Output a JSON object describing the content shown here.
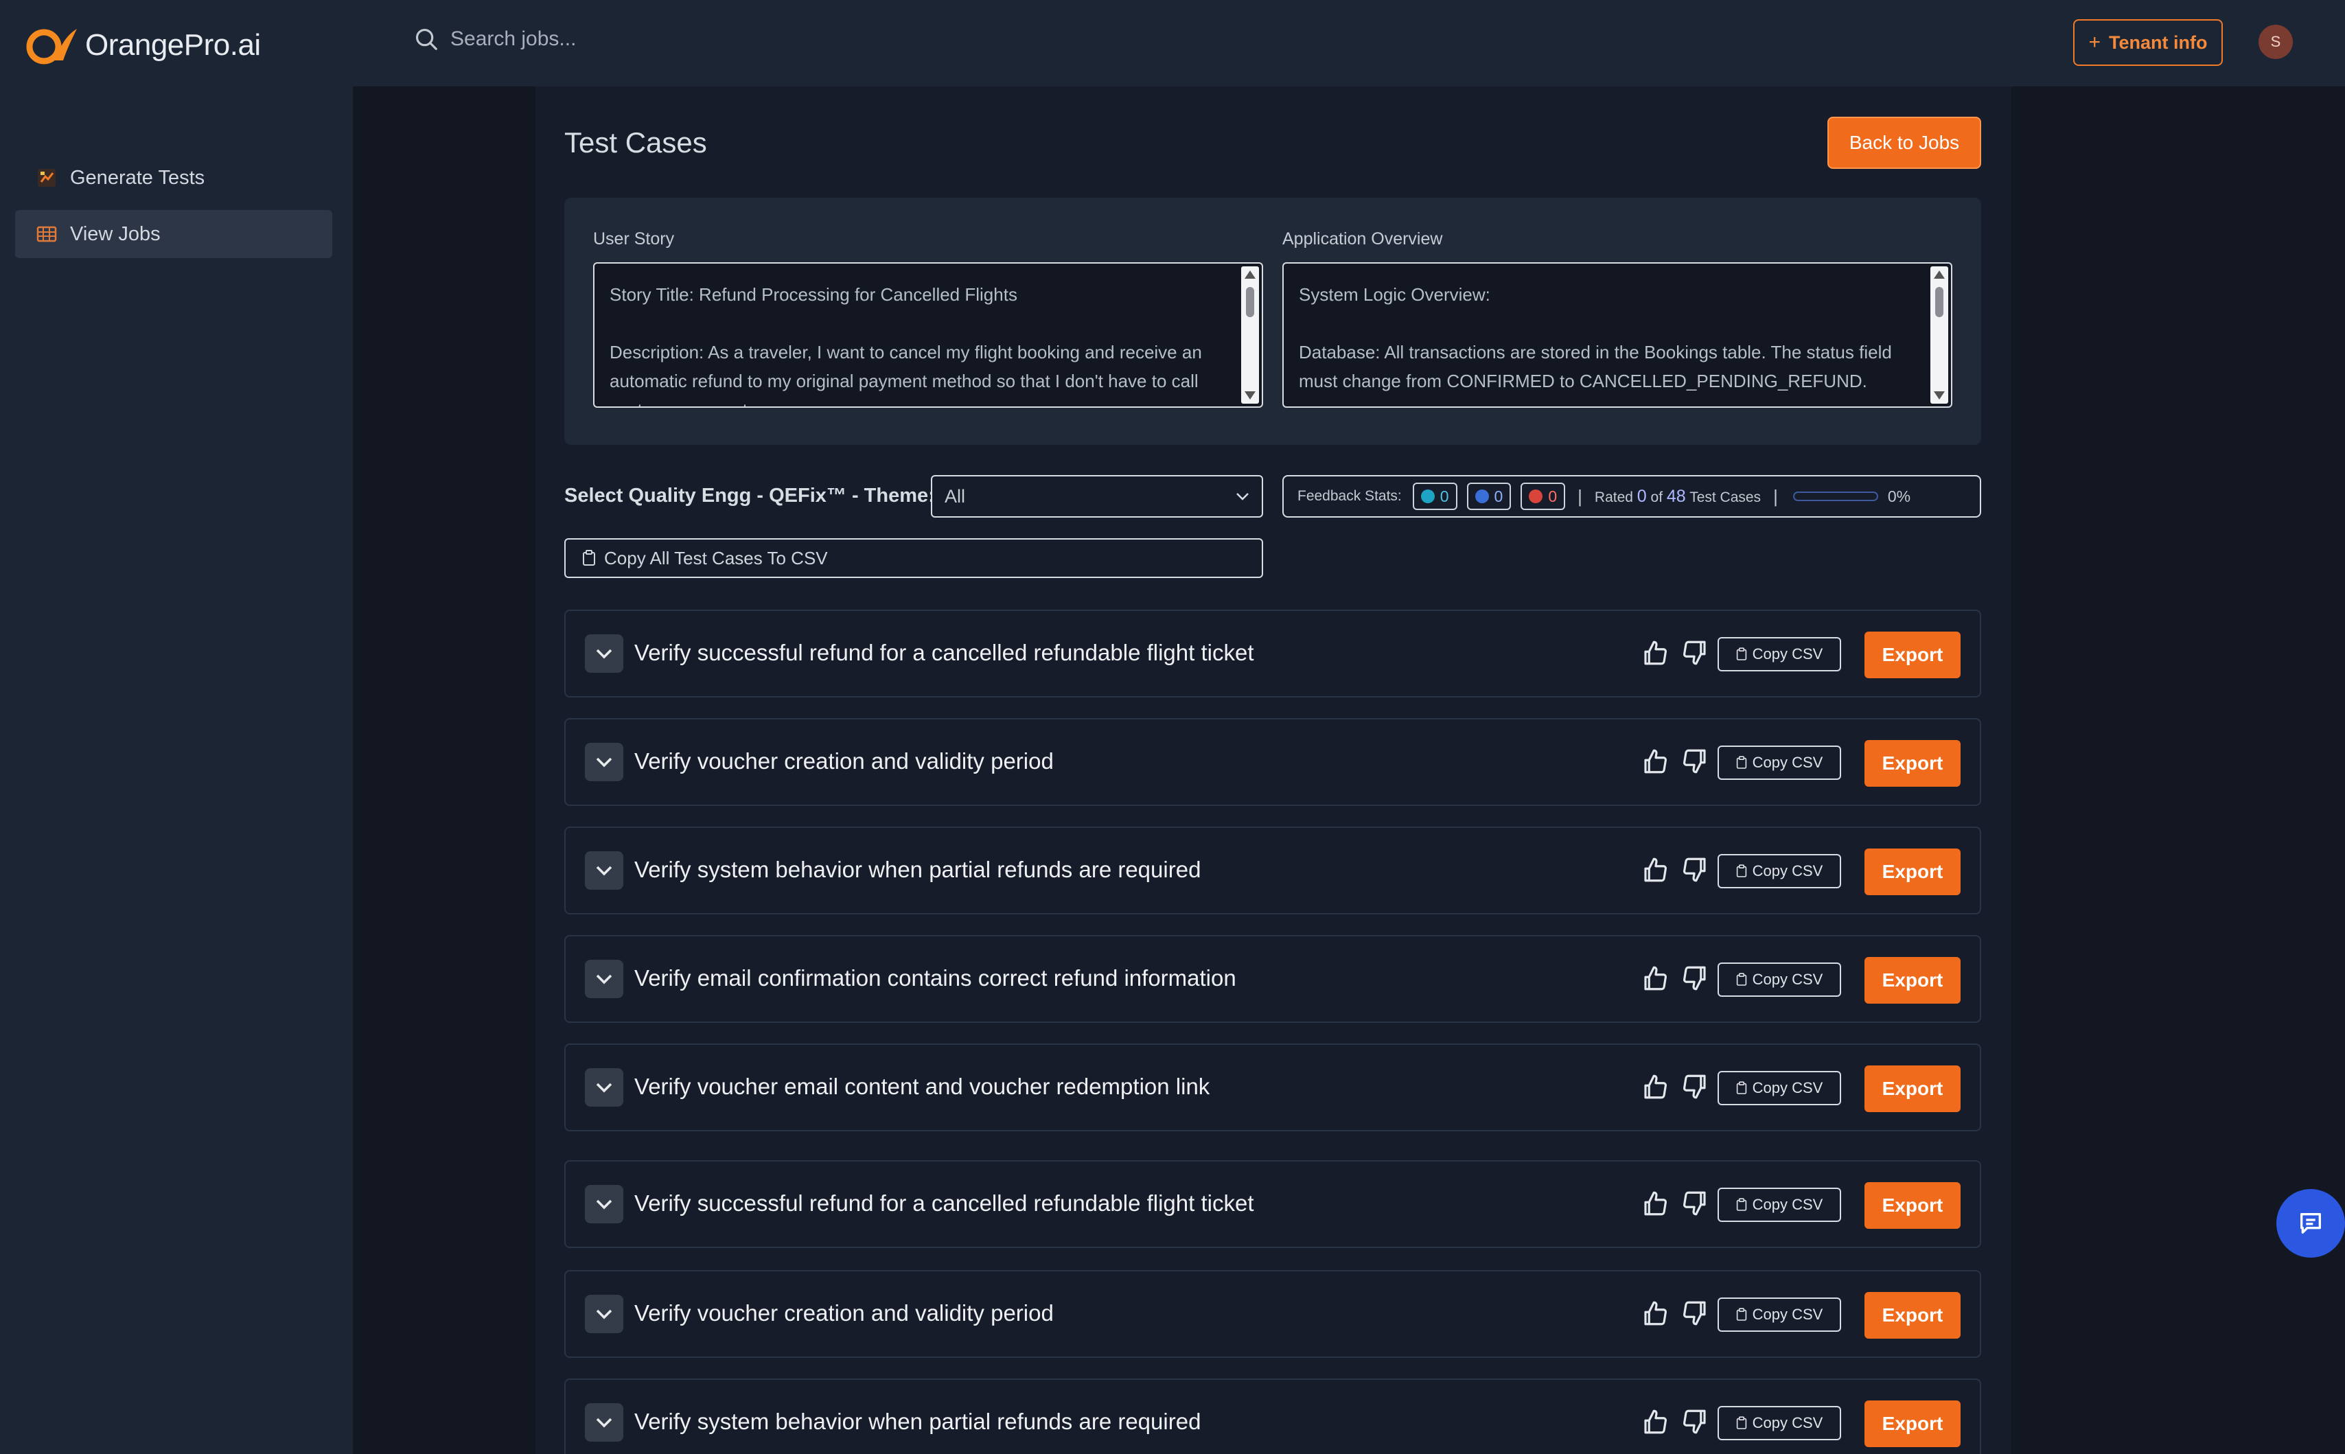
{
  "brand": {
    "name": "OrangePro.ai"
  },
  "header": {
    "search_placeholder": "Search jobs...",
    "tenant_label": "Tenant info",
    "avatar_initial": "S"
  },
  "sidebar": {
    "items": [
      {
        "label": "Generate Tests",
        "icon": "generate-icon"
      },
      {
        "label": "View Jobs",
        "icon": "table-grid-icon",
        "active": true
      }
    ]
  },
  "main": {
    "title": "Test Cases",
    "back_label": "Back to Jobs",
    "user_story": {
      "label": "User Story",
      "line1": "Story Title: Refund Processing for Cancelled Flights",
      "line2": "Description: As a traveler, I want to cancel my flight booking and receive an automatic refund to my original payment method so that I don't have to call customer support."
    },
    "app_overview": {
      "label": "Application Overview",
      "line1": "System Logic Overview:",
      "line2": "Database: All transactions are stored in the Bookings table. The status field must change from CONFIRMED to CANCELLED_PENDING_REFUND."
    },
    "theme": {
      "label": "Select Quality Engg - QEFix™ - Theme:",
      "selected": "All"
    },
    "feedback": {
      "label": "Feedback Stats:",
      "positive": "0",
      "neutral": "0",
      "negative": "0",
      "rated_prefix": "Rated",
      "rated_count": "0",
      "of": "of",
      "total": "48",
      "suffix": "Test Cases",
      "percent": "0%",
      "progress_fraction": 0,
      "colors": {
        "positive": "#1fa3c4",
        "neutral": "#3b6fd8",
        "negative": "#d9443b"
      }
    },
    "copy_all_label": "Copy All Test Cases To CSV",
    "card_labels": {
      "copy_csv": "Copy CSV",
      "export": "Export"
    },
    "test_cases": [
      {
        "title": "Verify successful refund for a cancelled refundable flight ticket"
      },
      {
        "title": "Verify voucher creation and validity period"
      },
      {
        "title": "Verify system behavior when partial refunds are required"
      },
      {
        "title": "Verify email confirmation contains correct refund information"
      },
      {
        "title": "Verify voucher email content and voucher redemption link"
      },
      {
        "title": "Verify successful refund for a cancelled refundable flight ticket"
      },
      {
        "title": "Verify voucher creation and validity period"
      },
      {
        "title": "Verify system behavior when partial refunds are required"
      }
    ]
  },
  "colors": {
    "accent": "#f06b1c",
    "sidebar_bg": "#1c2534",
    "page_bg": "#121722",
    "chat_fab": "#2c57e0"
  }
}
